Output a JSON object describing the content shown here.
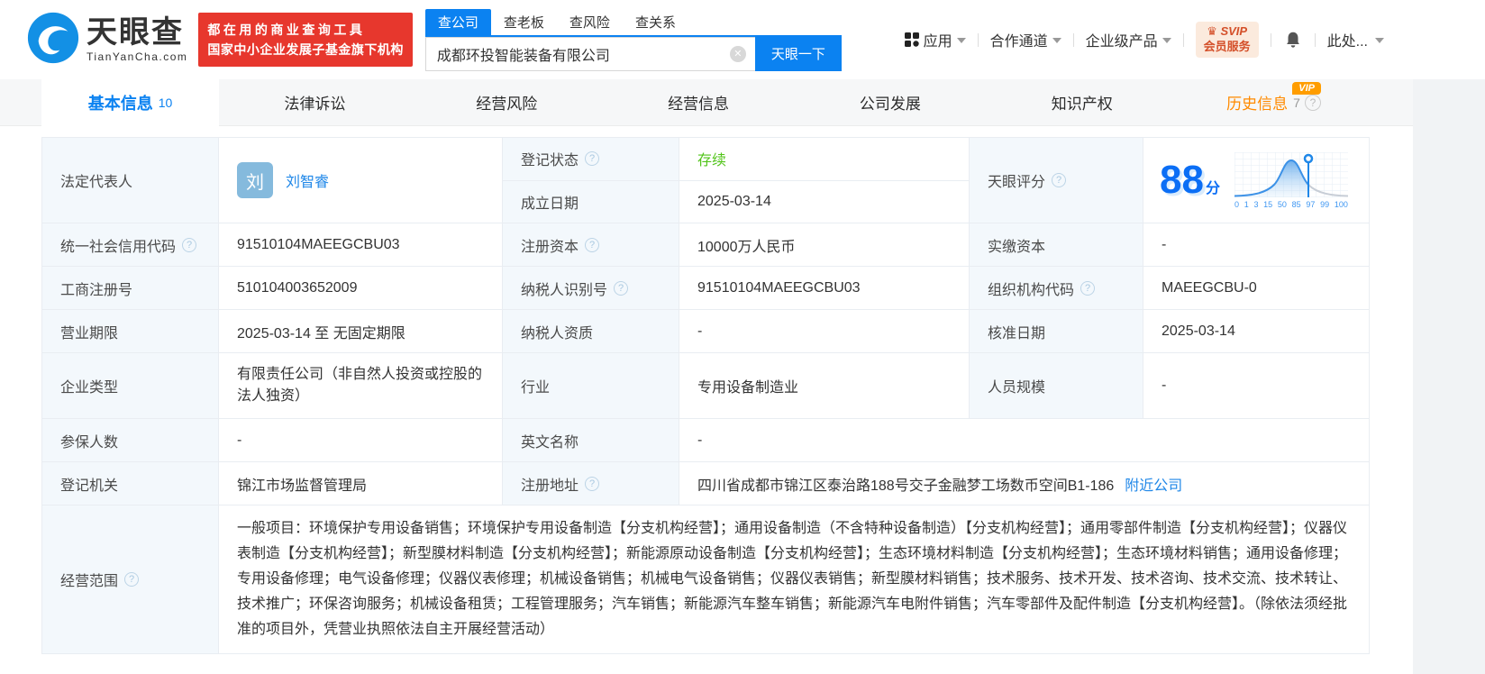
{
  "brand": {
    "logo_title": "天眼查",
    "logo_sub": "TianYanCha.com",
    "slogan_line1": "都在用的商业查询工具",
    "slogan_line2": "国家中小企业发展子基金旗下机构"
  },
  "icons": {
    "question": "?",
    "clear": "✕",
    "crown": "♛"
  },
  "search": {
    "tabs": [
      {
        "label": "查公司"
      },
      {
        "label": "查老板"
      },
      {
        "label": "查风险"
      },
      {
        "label": "查关系"
      }
    ],
    "input_value": "成都环投智能装备有限公司",
    "button_label": "天眼一下"
  },
  "top_nav": {
    "apps": "应用",
    "partner": "合作通道",
    "enterprise": "企业级产品",
    "svip_line1": "SVIP",
    "svip_line2": "会员服务",
    "user": "此处..."
  },
  "tabs": [
    {
      "label": "基本信息",
      "count": "10"
    },
    {
      "label": "法律诉讼"
    },
    {
      "label": "经营风险"
    },
    {
      "label": "经营信息"
    },
    {
      "label": "公司发展"
    },
    {
      "label": "知识产权"
    },
    {
      "label": "历史信息",
      "count": "7",
      "vip": "VIP"
    }
  ],
  "profile": {
    "legal_rep": {
      "label": "法定代表人",
      "avatar_char": "刘",
      "name": "刘智睿"
    },
    "reg_status": {
      "label": "登记状态",
      "value": "存续"
    },
    "establish_date": {
      "label": "成立日期",
      "value": "2025-03-14"
    },
    "score": {
      "label": "天眼评分",
      "value": "88",
      "unit": "分",
      "axis_ticks": [
        "0",
        "1",
        "3",
        "15",
        "50",
        "85",
        "97",
        "99",
        "100"
      ]
    },
    "credit_code": {
      "label": "统一社会信用代码",
      "value": "91510104MAEEGCBU03"
    },
    "reg_capital": {
      "label": "注册资本",
      "value": "10000万人民币"
    },
    "paid_capital": {
      "label": "实缴资本",
      "value": "-"
    },
    "reg_number": {
      "label": "工商注册号",
      "value": "510104003652009"
    },
    "taxpayer_id": {
      "label": "纳税人识别号",
      "value": "91510104MAEEGCBU03"
    },
    "org_code": {
      "label": "组织机构代码",
      "value": "MAEEGCBU-0"
    },
    "business_term": {
      "label": "营业期限",
      "value": "2025-03-14 至 无固定期限"
    },
    "taxpayer_quality": {
      "label": "纳税人资质",
      "value": "-"
    },
    "approval_date": {
      "label": "核准日期",
      "value": "2025-03-14"
    },
    "company_type": {
      "label": "企业类型",
      "value": "有限责任公司（非自然人投资或控股的法人独资）"
    },
    "industry": {
      "label": "行业",
      "value": "专用设备制造业"
    },
    "staff_size": {
      "label": "人员规模",
      "value": "-"
    },
    "insured_count": {
      "label": "参保人数",
      "value": "-"
    },
    "english_name": {
      "label": "英文名称",
      "value": "-"
    },
    "reg_authority": {
      "label": "登记机关",
      "value": "锦江市场监督管理局"
    },
    "reg_address": {
      "label": "注册地址",
      "value": "四川省成都市锦江区泰治路188号交子金融梦工场数币空间B1-186",
      "nearby_link": "附近公司"
    },
    "business_scope": {
      "label": "经营范围",
      "value": "一般项目：环境保护专用设备销售；环境保护专用设备制造【分支机构经营】；通用设备制造（不含特种设备制造）【分支机构经营】；通用零部件制造【分支机构经营】；仪器仪表制造【分支机构经营】；新型膜材料制造【分支机构经营】；新能源原动设备制造【分支机构经营】；生态环境材料制造【分支机构经营】；生态环境材料销售；通用设备修理；专用设备修理；电气设备修理；仪器仪表修理；机械设备销售；机械电气设备销售；仪器仪表销售；新型膜材料销售；技术服务、技术开发、技术咨询、技术交流、技术转让、技术推广；环保咨询服务；机械设备租赁；工程管理服务；汽车销售；新能源汽车整车销售；新能源汽车电附件销售；汽车零部件及配件制造【分支机构经营】。（除依法须经批准的项目外，凭营业执照依法自主开展经营活动）"
    }
  },
  "colors": {
    "accent_blue": "#0b82f1",
    "status_green": "#52c41a",
    "history_orange": "#ff8a00",
    "banner_red": "#e7372d"
  }
}
